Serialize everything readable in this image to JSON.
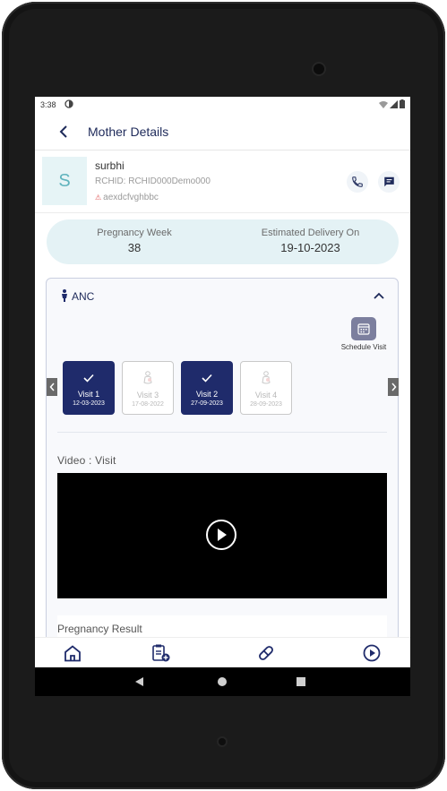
{
  "status_bar": {
    "time": "3:38"
  },
  "header": {
    "title": "Mother Details"
  },
  "profile": {
    "avatar_letter": "S",
    "name": "surbhi",
    "rchid": "RCHID: RCHID000Demo000",
    "alert_text": "aexdcfvghbbc"
  },
  "summary": {
    "pregnancy_week_label": "Pregnancy Week",
    "pregnancy_week_value": "38",
    "edd_label": "Estimated Delivery On",
    "edd_value": "19-10-2023"
  },
  "anc": {
    "title": "ANC",
    "schedule_label": "Schedule Visit",
    "visits": [
      {
        "label": "Visit 1",
        "date": "12-03-2023",
        "status": "done"
      },
      {
        "label": "Visit 3",
        "date": "17-08-2022",
        "status": "pending"
      },
      {
        "label": "Visit 2",
        "date": "27-09-2023",
        "status": "done"
      },
      {
        "label": "Visit 4",
        "date": "28-09-2023",
        "status": "pending"
      }
    ],
    "video_title": "Video : Visit",
    "pregnancy_result_label": "Pregnancy Result"
  },
  "bottom_nav": {
    "items": [
      "home-icon",
      "clipboard-add-icon",
      "pill-icon",
      "play-circle-icon"
    ]
  },
  "colors": {
    "primary": "#1f2b6b",
    "summary_bg": "#e4f2f5",
    "avatar_bg": "#e6f4f6",
    "alert": "#e05a5a"
  }
}
